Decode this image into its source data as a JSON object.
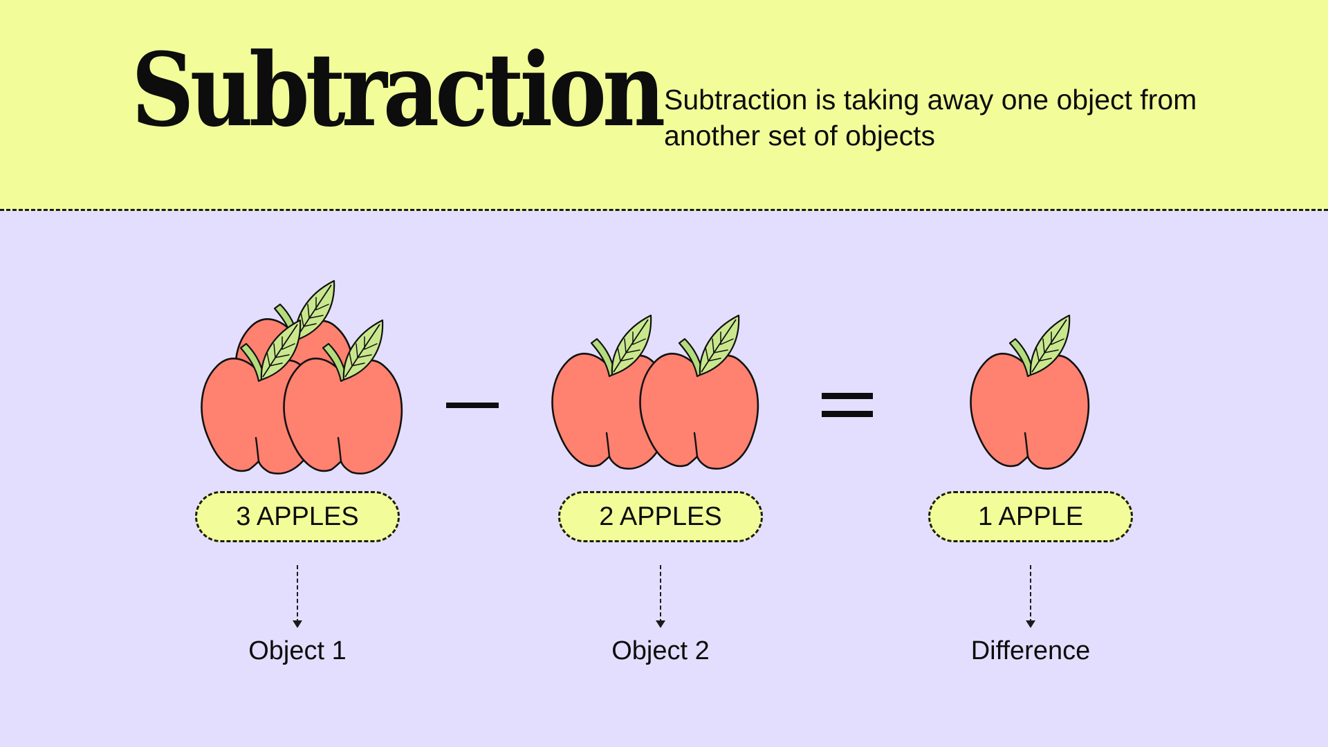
{
  "header": {
    "title": "Subtraction",
    "description": "Subtraction is taking away one object from another set of objects"
  },
  "colors": {
    "header_bg": "#f2fd9a",
    "main_bg": "#e3defe",
    "apple_fill": "#ff8170",
    "leaf_fill": "#c9e88e",
    "stem_fill": "#b4dc7c",
    "pill_fill": "#f2fd9a"
  },
  "icons": {
    "apple": "apple-icon",
    "minus": "minus-sign",
    "equals": "equals-sign"
  },
  "equation": {
    "object1": {
      "count": 3,
      "label": "3 APPLES",
      "caption": "Object 1"
    },
    "object2": {
      "count": 2,
      "label": "2 APPLES",
      "caption": "Object 2"
    },
    "difference": {
      "count": 1,
      "label": "1 APPLE",
      "caption": "Difference"
    }
  }
}
